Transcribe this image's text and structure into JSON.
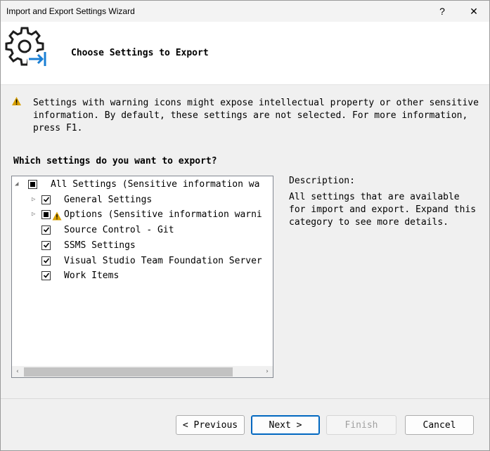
{
  "window": {
    "title": "Import and Export Settings Wizard",
    "help_label": "?",
    "close_label": "✕"
  },
  "header": {
    "title": "Choose Settings to Export",
    "icon": "settings-export-icon"
  },
  "warning": {
    "icon": "warning-icon",
    "text": "Settings with warning icons might expose intellectual property or other sensitive information. By default, these settings are not selected. For more information, press F1."
  },
  "question": "Which settings do you want to export?",
  "tree": {
    "items": [
      {
        "label": "All Settings (Sensitive information wa",
        "state": "partial",
        "expander": "expanded",
        "warning": false
      },
      {
        "label": "General Settings",
        "state": "checked",
        "expander": "collapsed",
        "warning": false
      },
      {
        "label": "Options (Sensitive information warni",
        "state": "partial",
        "expander": "collapsed",
        "warning": true
      },
      {
        "label": "Source Control - Git",
        "state": "checked",
        "expander": "none",
        "warning": false
      },
      {
        "label": "SSMS Settings",
        "state": "checked",
        "expander": "none",
        "warning": false
      },
      {
        "label": "Visual Studio Team Foundation Server",
        "state": "checked",
        "expander": "none",
        "warning": false
      },
      {
        "label": "Work Items",
        "state": "checked",
        "expander": "none",
        "warning": false
      }
    ]
  },
  "description": {
    "label": "Description:",
    "text": "All settings that are available for import and export. Expand this category to see more details."
  },
  "buttons": {
    "previous": "< Previous",
    "next": "Next >",
    "finish": "Finish",
    "cancel": "Cancel"
  },
  "colors": {
    "accent": "#0067c0",
    "warning": "#d8a000"
  }
}
